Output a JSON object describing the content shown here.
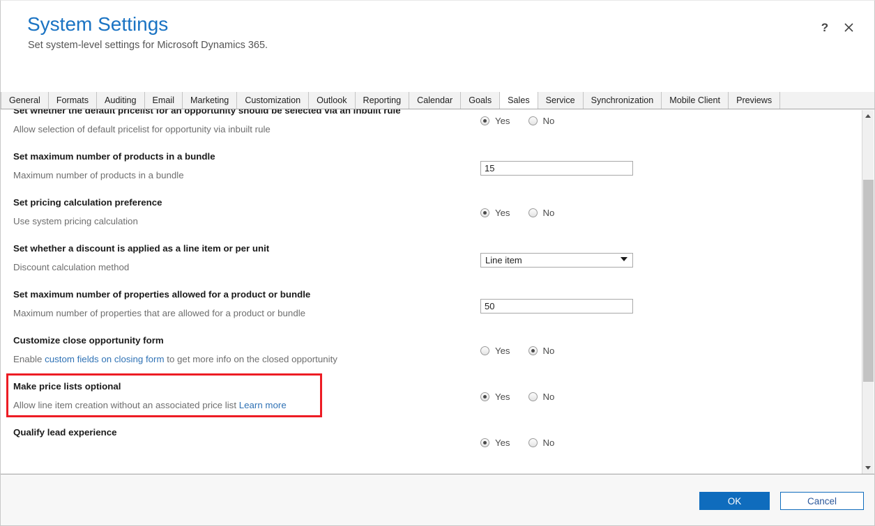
{
  "window": {
    "title": "System Settings",
    "subtitle": "Set system-level settings for Microsoft Dynamics 365.",
    "help_label": "?",
    "close_label": "✕"
  },
  "tabs": [
    {
      "label": "General",
      "active": false
    },
    {
      "label": "Formats",
      "active": false
    },
    {
      "label": "Auditing",
      "active": false
    },
    {
      "label": "Email",
      "active": false
    },
    {
      "label": "Marketing",
      "active": false
    },
    {
      "label": "Customization",
      "active": false
    },
    {
      "label": "Outlook",
      "active": false
    },
    {
      "label": "Reporting",
      "active": false
    },
    {
      "label": "Calendar",
      "active": false
    },
    {
      "label": "Goals",
      "active": false
    },
    {
      "label": "Sales",
      "active": true
    },
    {
      "label": "Service",
      "active": false
    },
    {
      "label": "Synchronization",
      "active": false
    },
    {
      "label": "Mobile Client",
      "active": false
    },
    {
      "label": "Previews",
      "active": false
    }
  ],
  "settings": [
    {
      "title": "Set whether the default pricelist for an opportunity should be selected via an inbuilt rule",
      "desc_pre": "Allow selection of default pricelist for opportunity via inbuilt rule",
      "desc_link": "",
      "desc_post": "",
      "control": "radio",
      "yes_label": "Yes",
      "no_label": "No",
      "value": "Yes"
    },
    {
      "title": "Set maximum number of products in a bundle",
      "desc_pre": "Maximum number of products in a bundle",
      "desc_link": "",
      "desc_post": "",
      "control": "text",
      "value": "15"
    },
    {
      "title": "Set pricing calculation preference",
      "desc_pre": "Use system pricing calculation",
      "desc_link": "",
      "desc_post": "",
      "control": "radio",
      "yes_label": "Yes",
      "no_label": "No",
      "value": "Yes"
    },
    {
      "title": "Set whether a discount is applied as a line item or per unit",
      "desc_pre": "Discount calculation method",
      "desc_link": "",
      "desc_post": "",
      "control": "select",
      "value": "Line item"
    },
    {
      "title": "Set maximum number of properties allowed for a product or bundle",
      "desc_pre": "Maximum number of properties that are allowed for a product or bundle",
      "desc_link": "",
      "desc_post": "",
      "control": "text",
      "value": "50"
    },
    {
      "title": "Customize close opportunity form",
      "desc_pre": "Enable ",
      "desc_link": "custom fields on closing form",
      "desc_post": " to get more info on the closed opportunity",
      "control": "radio",
      "yes_label": "Yes",
      "no_label": "No",
      "value": "No"
    },
    {
      "title": "Make price lists optional",
      "desc_pre": "Allow line item creation without an associated price list ",
      "desc_link": "Learn more",
      "desc_post": "",
      "control": "radio",
      "yes_label": "Yes",
      "no_label": "No",
      "value": "Yes",
      "highlighted": true
    },
    {
      "title": "Qualify lead experience",
      "desc_pre": "",
      "desc_link": "",
      "desc_post": "",
      "control": "radio",
      "yes_label": "Yes",
      "no_label": "No",
      "value": "Yes"
    }
  ],
  "footer": {
    "ok_label": "OK",
    "cancel_label": "Cancel"
  },
  "colors": {
    "accent": "#0f6cbd",
    "title": "#1a73c3",
    "link": "#2f72b5",
    "highlight": "#ed1c24"
  }
}
